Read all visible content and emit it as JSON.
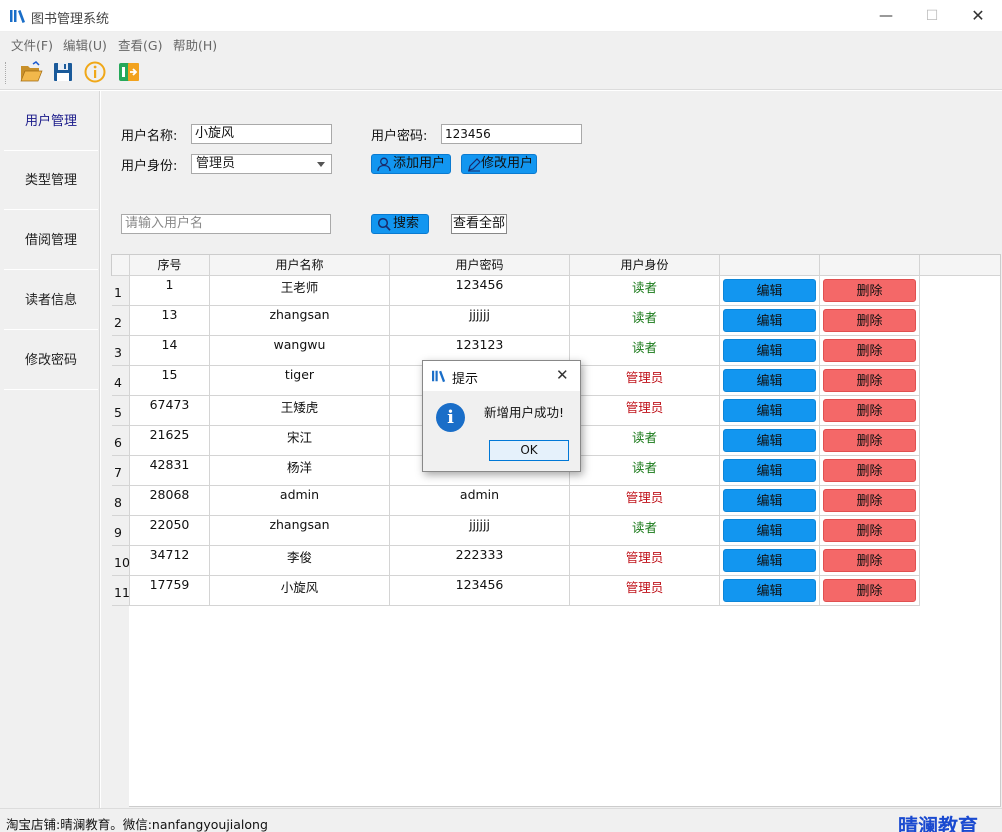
{
  "window": {
    "title": "图书管理系统",
    "minimize": "—",
    "maximize": "☐",
    "close": "✕"
  },
  "menu": [
    "文件(F)",
    "编辑(U)",
    "查看(G)",
    "帮助(H)"
  ],
  "toolbar": {
    "icons": [
      "open-folder-icon",
      "save-icon",
      "info-icon",
      "exit-icon"
    ]
  },
  "nav": [
    "用户管理",
    "类型管理",
    "借阅管理",
    "读者信息",
    "修改密码"
  ],
  "form": {
    "username_label": "用户名称:",
    "username_value": "小旋风",
    "password_label": "用户密码:",
    "password_value": "123456",
    "role_label": "用户身份:",
    "role_value": "管理员",
    "add_button": "添加用户",
    "edit_button": "修改用户",
    "search_placeholder": "请输入用户名",
    "search_button": "搜索",
    "show_all_button": "查看全部"
  },
  "table": {
    "headers": [
      "序号",
      "用户名称",
      "用户密码",
      "用户身份",
      "",
      ""
    ],
    "edit_label": "编辑",
    "delete_label": "删除",
    "rows": [
      {
        "num": "1",
        "id": "1",
        "name": "王老师",
        "password": "123456",
        "role": "读者",
        "role_type": "reader"
      },
      {
        "num": "2",
        "id": "13",
        "name": "zhangsan",
        "password": "jjjjjj",
        "role": "读者",
        "role_type": "reader"
      },
      {
        "num": "3",
        "id": "14",
        "name": "wangwu",
        "password": "123123",
        "role": "读者",
        "role_type": "reader"
      },
      {
        "num": "4",
        "id": "15",
        "name": "tiger",
        "password": "",
        "role": "管理员",
        "role_type": "admin"
      },
      {
        "num": "5",
        "id": "67473",
        "name": "王矮虎",
        "password": "",
        "role": "管理员",
        "role_type": "admin"
      },
      {
        "num": "6",
        "id": "21625",
        "name": "宋江",
        "password": "",
        "role": "读者",
        "role_type": "reader"
      },
      {
        "num": "7",
        "id": "42831",
        "name": "杨洋",
        "password": "",
        "role": "读者",
        "role_type": "reader"
      },
      {
        "num": "8",
        "id": "28068",
        "name": "admin",
        "password": "admin",
        "role": "管理员",
        "role_type": "admin"
      },
      {
        "num": "9",
        "id": "22050",
        "name": "zhangsan",
        "password": "jjjjjj",
        "role": "读者",
        "role_type": "reader"
      },
      {
        "num": "10",
        "id": "34712",
        "name": "李俊",
        "password": "222333",
        "role": "管理员",
        "role_type": "admin"
      },
      {
        "num": "11",
        "id": "17759",
        "name": "小旋风",
        "password": "123456",
        "role": "管理员",
        "role_type": "admin"
      }
    ]
  },
  "dialog": {
    "title": "提示",
    "message": "新增用户成功!",
    "ok": "OK",
    "close": "✕"
  },
  "status": {
    "text": "淘宝店铺:晴澜教育。微信:nanfangyoujialong",
    "brand": "晴澜教育"
  },
  "colors": {
    "accent_blue": "#1296f0",
    "delete_red": "#f46868",
    "reader_green": "#1a7a1a",
    "admin_red": "#c0141c",
    "brand_blue": "#1a4ad0"
  }
}
